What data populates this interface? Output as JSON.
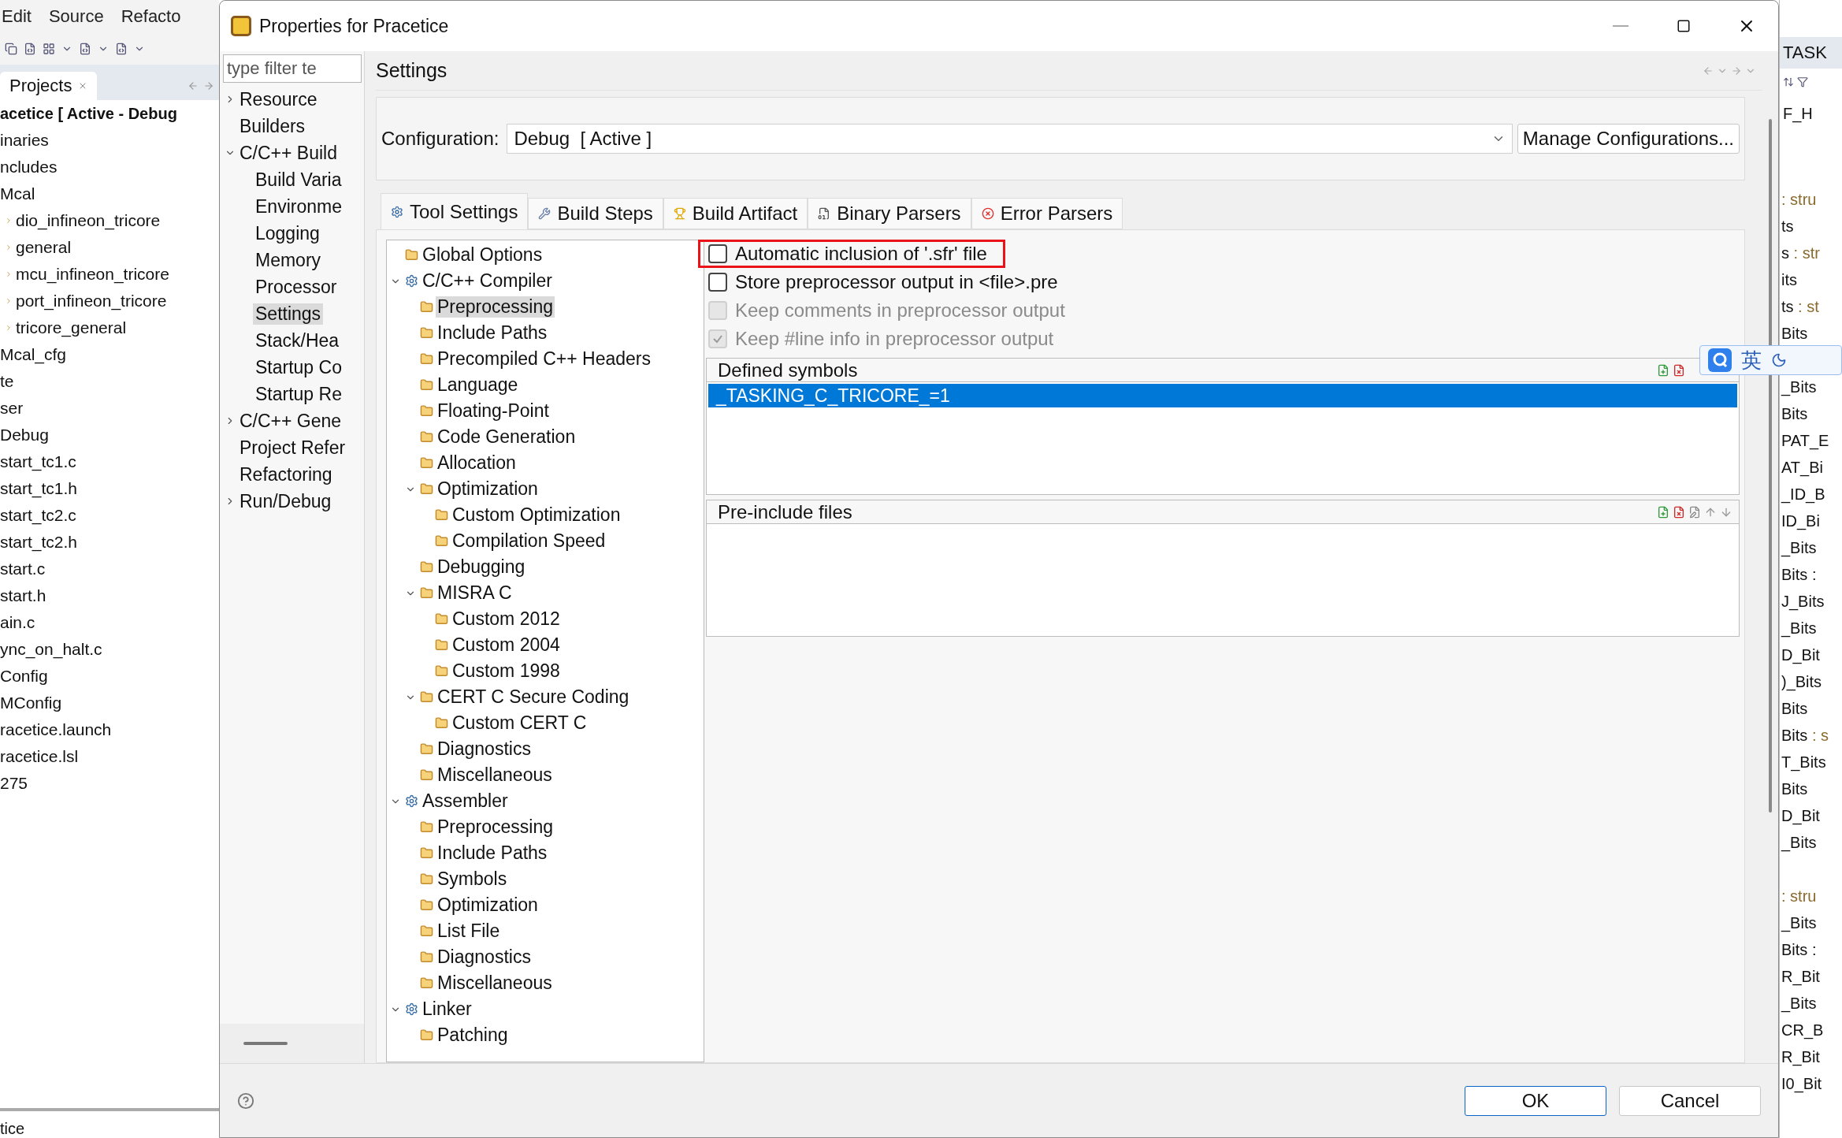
{
  "ide": {
    "menu": [
      "Edit",
      "Source",
      "Refacto"
    ],
    "projects_tab": {
      "label": "Projects"
    },
    "project_title": "acetice [ Active - Debug",
    "project_tree": [
      {
        "label": "inaries"
      },
      {
        "label": "ncludes"
      },
      {
        "label": "Mcal",
        "children": [
          {
            "label": "dio_infineon_tricore"
          },
          {
            "label": "general"
          },
          {
            "label": "mcu_infineon_tricore"
          },
          {
            "label": "port_infineon_tricore"
          },
          {
            "label": "tricore_general"
          }
        ]
      },
      {
        "label": "Mcal_cfg"
      },
      {
        "label": "te"
      },
      {
        "label": "ser"
      },
      {
        "label": "Debug"
      },
      {
        "label": "start_tc1.c"
      },
      {
        "label": "start_tc1.h"
      },
      {
        "label": "start_tc2.c"
      },
      {
        "label": "start_tc2.h"
      },
      {
        "label": "start.c"
      },
      {
        "label": "start.h"
      },
      {
        "label": "ain.c"
      },
      {
        "label": "ync_on_halt.c"
      },
      {
        "label": "Config"
      },
      {
        "label": "MConfig"
      },
      {
        "label": "racetice.launch"
      },
      {
        "label": "racetice.lsl"
      },
      {
        "label": "275"
      }
    ],
    "status": "tice"
  },
  "dialog": {
    "title": "Properties for Pracetice",
    "filter": {
      "placeholder": "type filter te"
    },
    "nav": [
      {
        "label": "Resource",
        "expanded": false,
        "selected": false
      },
      {
        "label": "Builders",
        "selected": false
      },
      {
        "label": "C/C++ Build",
        "expanded": true,
        "selected": false,
        "children": [
          {
            "label": "Build Varia",
            "selected": false
          },
          {
            "label": "Environme",
            "selected": false
          },
          {
            "label": "Logging",
            "selected": false
          },
          {
            "label": "Memory",
            "selected": false
          },
          {
            "label": "Processor",
            "selected": false
          },
          {
            "label": "Settings",
            "selected": true
          },
          {
            "label": "Stack/Hea",
            "selected": false
          },
          {
            "label": "Startup Co",
            "selected": false
          },
          {
            "label": "Startup Re",
            "selected": false
          }
        ]
      },
      {
        "label": "C/C++ Gene",
        "expanded": false,
        "selected": false
      },
      {
        "label": "Project Refer",
        "selected": false
      },
      {
        "label": "Refactoring",
        "selected": false
      },
      {
        "label": "Run/Debug",
        "expanded": false,
        "selected": false
      }
    ],
    "page_title": "Settings",
    "configuration": {
      "label": "Configuration:",
      "value": "Debug  [ Active ]",
      "button": "Manage Configurations..."
    },
    "tabs": [
      {
        "label": "Tool Settings",
        "kind": "gear",
        "selected": true
      },
      {
        "label": "Build Steps",
        "kind": "wrench",
        "selected": false
      },
      {
        "label": "Build Artifact",
        "kind": "trophy",
        "selected": false
      },
      {
        "label": "Binary Parsers",
        "kind": "binary",
        "selected": false
      },
      {
        "label": "Error Parsers",
        "kind": "error",
        "selected": false
      }
    ],
    "tool_tree": [
      {
        "label": "Global Options",
        "kind": "folder",
        "selected": false
      },
      {
        "label": "C/C++ Compiler",
        "kind": "tool",
        "expanded": true,
        "selected": false,
        "children": [
          {
            "label": "Preprocessing",
            "kind": "folder",
            "selected": true
          },
          {
            "label": "Include Paths",
            "kind": "folder",
            "selected": false
          },
          {
            "label": "Precompiled C++ Headers",
            "kind": "folder",
            "selected": false
          },
          {
            "label": "Language",
            "kind": "folder",
            "selected": false
          },
          {
            "label": "Floating-Point",
            "kind": "folder",
            "selected": false
          },
          {
            "label": "Code Generation",
            "kind": "folder",
            "selected": false
          },
          {
            "label": "Allocation",
            "kind": "folder",
            "selected": false
          },
          {
            "label": "Optimization",
            "kind": "folder",
            "expanded": true,
            "selected": false,
            "children": [
              {
                "label": "Custom Optimization",
                "kind": "folder",
                "selected": false
              },
              {
                "label": "Compilation Speed",
                "kind": "folder",
                "selected": false
              }
            ]
          },
          {
            "label": "Debugging",
            "kind": "folder",
            "selected": false
          },
          {
            "label": "MISRA C",
            "kind": "folder",
            "expanded": true,
            "selected": false,
            "children": [
              {
                "label": "Custom 2012",
                "kind": "folder",
                "selected": false
              },
              {
                "label": "Custom 2004",
                "kind": "folder",
                "selected": false
              },
              {
                "label": "Custom 1998",
                "kind": "folder",
                "selected": false
              }
            ]
          },
          {
            "label": "CERT C Secure Coding",
            "kind": "folder",
            "expanded": true,
            "selected": false,
            "children": [
              {
                "label": "Custom CERT C",
                "kind": "folder",
                "selected": false
              }
            ]
          },
          {
            "label": "Diagnostics",
            "kind": "folder",
            "selected": false
          },
          {
            "label": "Miscellaneous",
            "kind": "folder",
            "selected": false
          }
        ]
      },
      {
        "label": "Assembler",
        "kind": "tool",
        "expanded": true,
        "selected": false,
        "children": [
          {
            "label": "Preprocessing",
            "kind": "folder",
            "selected": false
          },
          {
            "label": "Include Paths",
            "kind": "folder",
            "selected": false
          },
          {
            "label": "Symbols",
            "kind": "folder",
            "selected": false
          },
          {
            "label": "Optimization",
            "kind": "folder",
            "selected": false
          },
          {
            "label": "List File",
            "kind": "folder",
            "selected": false
          },
          {
            "label": "Diagnostics",
            "kind": "folder",
            "selected": false
          },
          {
            "label": "Miscellaneous",
            "kind": "folder",
            "selected": false
          }
        ]
      },
      {
        "label": "Linker",
        "kind": "tool",
        "expanded": true,
        "selected": false,
        "children": [
          {
            "label": "Patching",
            "kind": "folder",
            "selected": false
          }
        ]
      }
    ],
    "options": [
      {
        "label": "Automatic inclusion of '.sfr' file",
        "checked": false,
        "disabled": false,
        "highlighted": true
      },
      {
        "label": "Store preprocessor output in <file>.pre",
        "checked": false,
        "disabled": false,
        "highlighted": false
      },
      {
        "label": "Keep comments in preprocessor output",
        "checked": false,
        "disabled": true,
        "highlighted": false
      },
      {
        "label": "Keep #line info in preprocessor output",
        "checked": true,
        "disabled": true,
        "highlighted": false
      }
    ],
    "lists": [
      {
        "title": "Defined symbols",
        "tools": [
          {
            "kind": "add"
          },
          {
            "kind": "delete"
          }
        ],
        "items": [
          {
            "text": "_TASKING_C_TRICORE_=1",
            "selected": true
          }
        ]
      },
      {
        "title": "Pre-include files",
        "tools": [
          {
            "kind": "add"
          },
          {
            "kind": "delete"
          },
          {
            "kind": "edit"
          },
          {
            "kind": "up"
          },
          {
            "kind": "down"
          }
        ]
      }
    ],
    "buttons": [
      {
        "label": "OK",
        "default": true
      },
      {
        "label": "Cancel",
        "default": false
      }
    ]
  },
  "outline": {
    "tab": "TASK",
    "header_item": "F_H",
    "groups": [
      [
        {
          "type": ": stru"
        },
        {
          "text": "ts"
        },
        {
          "text": "s",
          "type": " : str"
        },
        {
          "text": "its"
        },
        {
          "text": "ts",
          "type": " : st"
        },
        {
          "text": "Bits"
        }
      ],
      [
        {
          "text": "_Bits"
        },
        {
          "text": "Bits"
        },
        {
          "text": "PAT_E"
        },
        {
          "text": "AT_Bi"
        },
        {
          "text": "_ID_B"
        },
        {
          "text": "ID_Bi"
        },
        {
          "text": "_Bits"
        },
        {
          "text": "Bits :"
        },
        {
          "text": "J_Bits"
        },
        {
          "text": "_Bits"
        },
        {
          "text": "D_Bit"
        },
        {
          "text": ")_Bits"
        },
        {
          "text": "Bits"
        },
        {
          "text": "Bits",
          "type": " : s"
        },
        {
          "text": "T_Bits"
        },
        {
          "text": "Bits"
        },
        {
          "text": "D_Bit"
        },
        {
          "text": "_Bits"
        }
      ],
      [
        {
          "type": ": stru"
        },
        {
          "text": "_Bits"
        },
        {
          "text": "Bits :"
        },
        {
          "text": "R_Bit"
        },
        {
          "text": "_Bits"
        },
        {
          "text": "CR_B"
        },
        {
          "text": "R_Bit"
        },
        {
          "text": "I0_Bit"
        }
      ]
    ]
  },
  "ime": {
    "label": "英"
  }
}
